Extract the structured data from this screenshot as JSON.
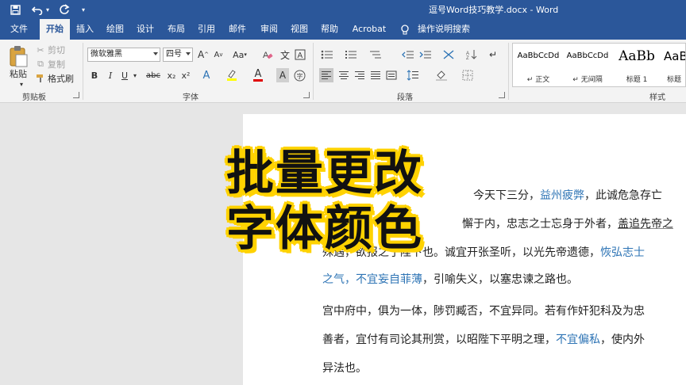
{
  "window": {
    "title": "逗号Word技巧教学.docx  -  Word"
  },
  "quick_access": {
    "save_icon": "save-icon",
    "undo_icon": "undo-icon",
    "redo_icon": "redo-icon",
    "customize_icon": "customize-icon"
  },
  "tabs": {
    "file": "文件",
    "home": "开始",
    "insert": "插入",
    "draw": "绘图",
    "design": "设计",
    "layout": "布局",
    "references": "引用",
    "mailings": "邮件",
    "review": "审阅",
    "view": "视图",
    "help": "帮助",
    "acrobat": "Acrobat",
    "tell_me": "操作说明搜索"
  },
  "ribbon": {
    "clipboard": {
      "label": "剪贴板",
      "paste": "粘贴",
      "cut": "剪切",
      "copy": "复制",
      "format_painter": "格式刷"
    },
    "font": {
      "label": "字体",
      "font_name": "微软雅黑",
      "font_size": "四号",
      "grow": "A",
      "shrink": "A",
      "case": "Aa",
      "bold": "B",
      "italic": "I",
      "underline": "U",
      "strike": "abc",
      "subscript": "x₂",
      "superscript": "x²",
      "text_effects": "A",
      "font_color": "A",
      "char_shading": "A",
      "enclose": "字"
    },
    "paragraph": {
      "label": "段落"
    },
    "styles": {
      "label": "样式",
      "items": [
        {
          "preview": "AaBbCcDd",
          "name": "↵ 正文"
        },
        {
          "preview": "AaBbCcDd",
          "name": "↵ 无间隔"
        },
        {
          "preview": "AaBb",
          "name": "标题 1"
        },
        {
          "preview": "AaBb",
          "name": "标题"
        }
      ]
    }
  },
  "overlay": {
    "line1": "批量更改",
    "line2": "字体颜色"
  },
  "document": {
    "p1_a": "今天下三分，",
    "p1_b": "益州疲弊",
    "p1_c": "，此诚危急存亡",
    "p2_a": "懈于内，忠志之士忘身于外者，",
    "p2_b": "盖追先帝之",
    "p3_a": "殊遇，欲报之于陛下也。诚宜开张圣听，以光先帝遗德，",
    "p3_b": "恢弘志士",
    "p4_a": "之气，不宜妄自菲薄",
    "p4_b": "，引喻失义，以塞忠谏之路也。",
    "p5": "宫中府中，俱为一体，陟罚臧否，不宜异同。若有作奸犯科及为忠",
    "p6_a": "善者，宜付有司论其刑赏，以昭陛下平明之理，",
    "p6_b": "不宜偏私",
    "p6_c": "，使内外",
    "p7": "异法也。"
  }
}
